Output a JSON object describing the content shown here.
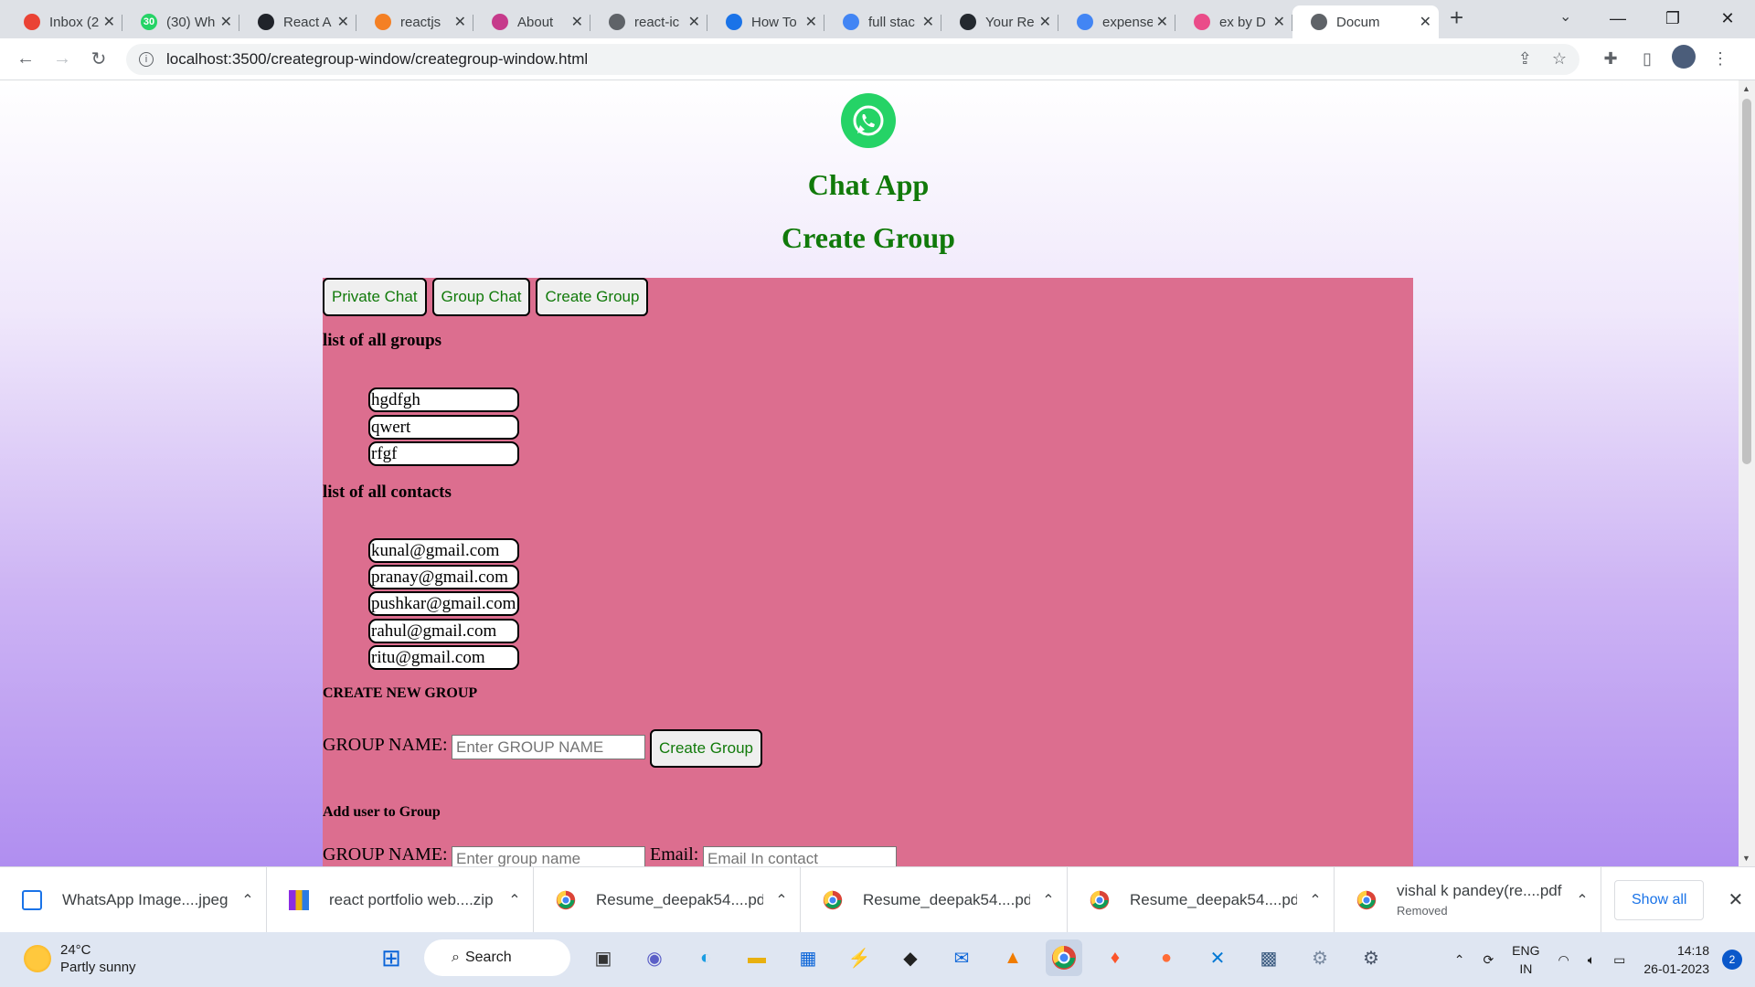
{
  "browser": {
    "tabs": [
      {
        "title": "Inbox (2",
        "favicon": "gmail-icon",
        "color": "#ea4335"
      },
      {
        "title": "(30) Wh",
        "favicon": "whatsapp-icon",
        "color": "#25d366",
        "badge": "30"
      },
      {
        "title": "React A",
        "favicon": "react-icon",
        "color": "#20232a"
      },
      {
        "title": "reactjs",
        "favicon": "stackoverflow-icon",
        "color": "#f48024"
      },
      {
        "title": "About",
        "favicon": "about-icon",
        "color": "#c63a8b"
      },
      {
        "title": "react-ic",
        "favicon": "globe-icon",
        "color": "#5f6368"
      },
      {
        "title": "How To",
        "favicon": "info-icon",
        "color": "#1a73e8"
      },
      {
        "title": "full stac",
        "favicon": "google-icon",
        "color": "#4285f4"
      },
      {
        "title": "Your Re",
        "favicon": "github-icon",
        "color": "#24292f"
      },
      {
        "title": "expense",
        "favicon": "google-icon",
        "color": "#4285f4"
      },
      {
        "title": "ex by D",
        "favicon": "dribbble-icon",
        "color": "#ea4c89"
      },
      {
        "title": "Docum",
        "favicon": "globe-icon",
        "color": "#5f6368",
        "active": true
      }
    ],
    "url": "localhost:3500/creategroup-window/creategroup-window.html"
  },
  "page": {
    "app_title": "Chat App",
    "page_title": "Create Group",
    "nav": {
      "private_chat": "Private Chat",
      "group_chat": "Group Chat",
      "create_group": "Create Group"
    },
    "groups_heading": "list of all groups",
    "groups": [
      "hgdfgh",
      "qwert",
      "rfgf"
    ],
    "contacts_heading": "list of all contacts",
    "contacts": [
      "kunal@gmail.com",
      "pranay@gmail.com",
      "pushkar@gmail.com",
      "rahul@gmail.com",
      "ritu@gmail.com"
    ],
    "create_heading": "CREATE NEW GROUP",
    "group_name_label": "GROUP NAME:",
    "group_name_placeholder": "Enter GROUP NAME",
    "create_button": "Create Group",
    "add_user_heading": "Add user to Group",
    "add_group_name_label": "GROUP NAME:",
    "add_group_name_placeholder": "Enter group name",
    "email_label": "Email:",
    "email_placeholder": "Email In contact"
  },
  "downloads": {
    "items": [
      {
        "name": "WhatsApp Image....jpeg",
        "icon": "image-file-icon"
      },
      {
        "name": "react portfolio web....zip",
        "icon": "zip-file-icon"
      },
      {
        "name": "Resume_deepak54....pdf",
        "icon": "chrome-icon"
      },
      {
        "name": "Resume_deepak54....pdf",
        "icon": "chrome-icon"
      },
      {
        "name": "Resume_deepak54....pdf",
        "icon": "chrome-icon"
      },
      {
        "name": "vishal k pandey(re....pdf",
        "icon": "chrome-icon",
        "status": "Removed"
      }
    ],
    "show_all": "Show all"
  },
  "taskbar": {
    "temperature": "24°C",
    "weather": "Partly sunny",
    "search": "Search",
    "lang_top": "ENG",
    "lang_bottom": "IN",
    "time": "14:18",
    "date": "26-01-2023",
    "notifications": "2"
  }
}
